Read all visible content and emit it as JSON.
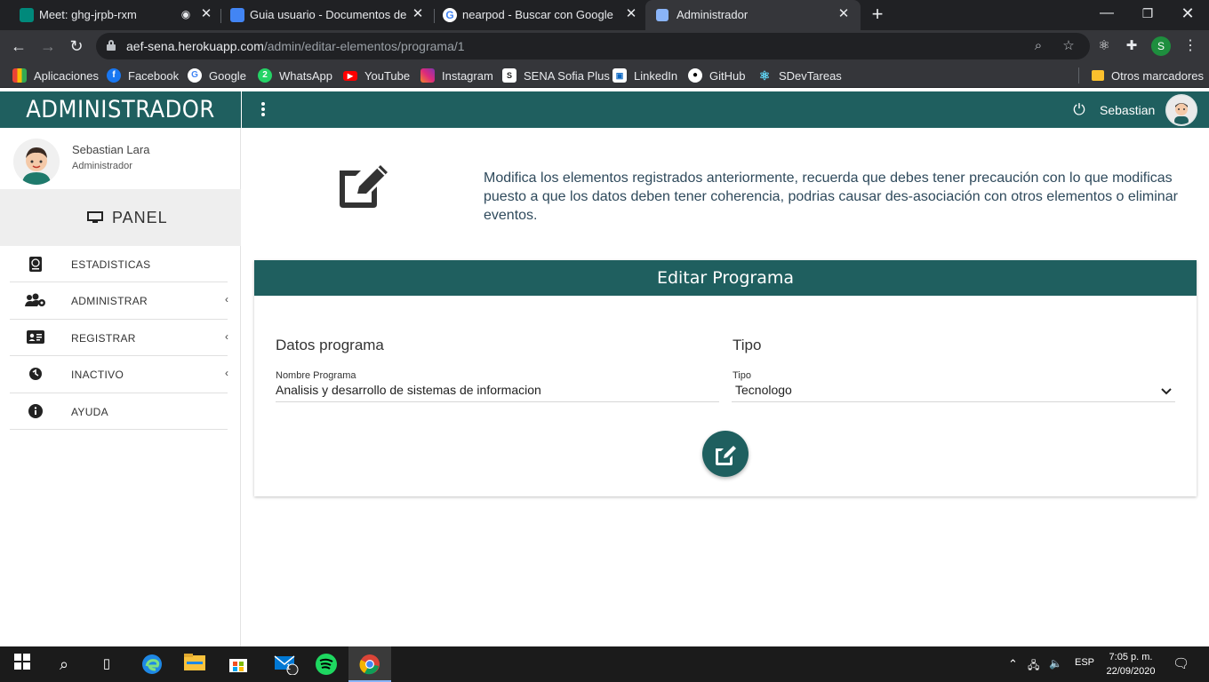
{
  "browser": {
    "tabs": [
      {
        "title": "Meet: ghg-jrpb-rxm",
        "icon": "meet-icon",
        "active": false
      },
      {
        "title": "Guia usuario - Documentos de Go",
        "icon": "docs-icon",
        "active": false
      },
      {
        "title": "nearpod - Buscar con Google",
        "icon": "google-icon",
        "active": false
      },
      {
        "title": "Administrador",
        "icon": "page-icon",
        "active": true
      }
    ],
    "url_host": "aef-sena.herokuapp.com",
    "url_path": "/admin/editar-elementos/programa/1",
    "profile_initial": "S",
    "bookmarks": [
      "Aplicaciones",
      "Facebook",
      "Google",
      "WhatsApp",
      "YouTube",
      "Instagram",
      "SENA Sofia Plus",
      "LinkedIn",
      "GitHub",
      "SDevTareas"
    ],
    "other_bookmarks": "Otros marcadores"
  },
  "app": {
    "brand": "ADMINISTRADOR",
    "header_user": "Sebastian",
    "sidebar": {
      "user_name": "Sebastian Lara",
      "user_role": "Administrador",
      "panel_label": "PANEL",
      "items": [
        {
          "label": "ESTADISTICAS",
          "icon": "passport-icon",
          "has_submenu": false
        },
        {
          "label": "ADMINISTRAR",
          "icon": "users-cog-icon",
          "has_submenu": true
        },
        {
          "label": "REGISTRAR",
          "icon": "id-card-icon",
          "has_submenu": true
        },
        {
          "label": "INACTIVO",
          "icon": "inactive-icon",
          "has_submenu": true
        },
        {
          "label": "AYUDA",
          "icon": "info-icon",
          "has_submenu": false
        }
      ]
    },
    "intro_text": "Modifica los elementos registrados anteriormente, recuerda que debes tener precaución con lo que modificas puesto a que los datos deben tener coherencia, podrias causar des-asociación con otros elementos o eliminar eventos.",
    "card": {
      "title": "Editar Programa",
      "left_section": "Datos programa",
      "right_section": "Tipo",
      "name_label": "Nombre Programa",
      "name_value": "Analisis y desarrollo de sistemas de informacion",
      "type_label": "Tipo",
      "type_value": "Tecnologo"
    },
    "colors": {
      "primary": "#1f5f5f"
    }
  },
  "taskbar": {
    "lang": "ESP",
    "time": "7:05 p. m.",
    "date": "22/09/2020",
    "mail_badge": "1"
  }
}
